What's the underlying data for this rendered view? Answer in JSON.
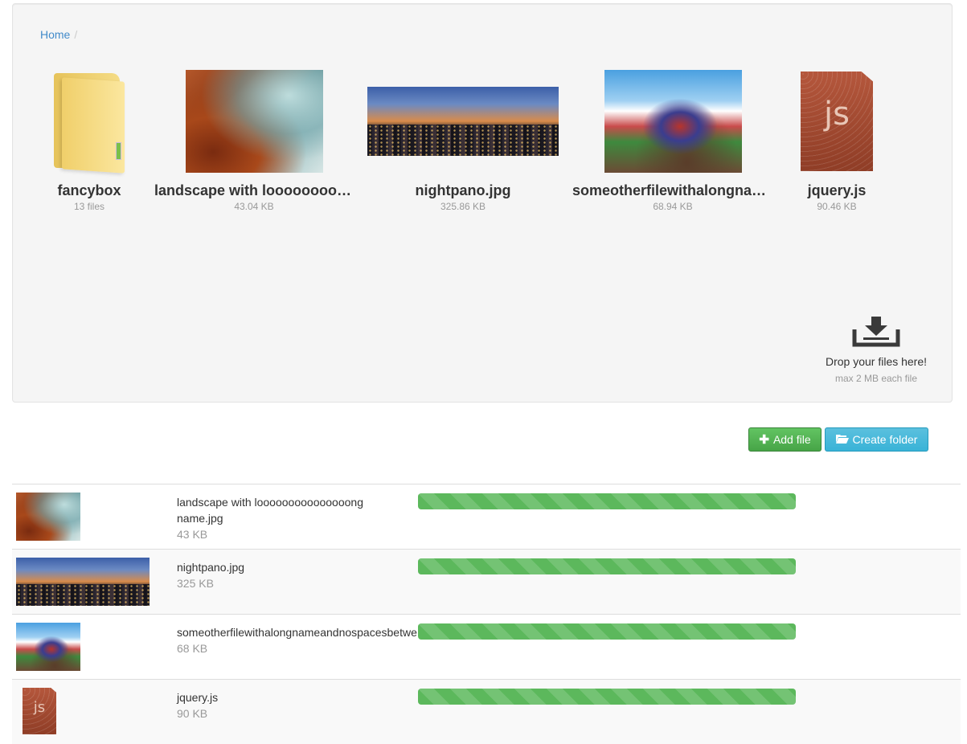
{
  "breadcrumb": {
    "home": "Home",
    "separator": "/"
  },
  "grid": [
    {
      "name": "fancybox",
      "meta": "13 files",
      "icon": "folder-icon"
    },
    {
      "name": "landscape with looooooooooooooong name.jpg",
      "meta": "43.04 KB"
    },
    {
      "name": "nightpano.jpg",
      "meta": "325.86 KB"
    },
    {
      "name": "someotherfilewithalongnameandnospacesbetweenwords.jpg",
      "meta": "68.94 KB"
    },
    {
      "name": "jquery.js",
      "meta": "90.46 KB",
      "icon": "js-file-icon",
      "icon_text": "js"
    }
  ],
  "dropzone": {
    "label": "Drop your files here!",
    "sub": "max 2 MB each file",
    "icon": "download-tray-icon"
  },
  "buttons": {
    "add_file": "Add file",
    "create_folder": "Create folder"
  },
  "uploads": [
    {
      "name": "landscape with looooooooooooooong name.jpg",
      "size": "43 KB",
      "progress": 1.0
    },
    {
      "name": "nightpano.jpg",
      "size": "325 KB",
      "progress": 1.0
    },
    {
      "name": "someotherfilewithalongnameandnospacesbetwe",
      "size": "68 KB",
      "progress": 1.0
    },
    {
      "name": "jquery.js",
      "size": "90 KB",
      "progress": 1.0,
      "icon_text": "js"
    }
  ],
  "colors": {
    "success": "#5cb85c",
    "info": "#5bc0de",
    "link": "#428bca"
  }
}
